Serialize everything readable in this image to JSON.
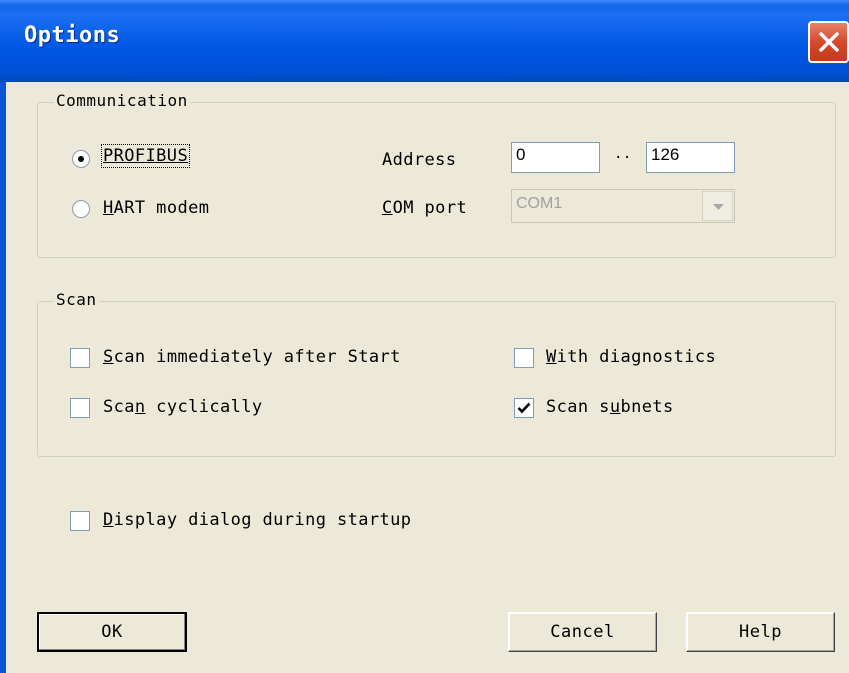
{
  "window": {
    "title": "Options"
  },
  "communication": {
    "group_label": "Communication",
    "profibus_label": "PROFIBUS",
    "hart_prefix": "H",
    "hart_label": "ART modem",
    "profibus_selected": true,
    "address_label": "Address",
    "address_from": "0",
    "address_separator": "··",
    "address_to": "126",
    "com_port_prefix": "C",
    "com_port_label": "OM port",
    "com_port_value": "COM1"
  },
  "scan": {
    "group_label": "Scan",
    "scan_immediately_prefix": "S",
    "scan_immediately_label": "can immediately after Start",
    "scan_immediately_checked": false,
    "scan_cyclically_a": "Sca",
    "scan_cyclically_u": "n",
    "scan_cyclically_b": " cyclically",
    "scan_cyclically_checked": false,
    "with_diag_prefix": "W",
    "with_diag_label": "ith diagnostics",
    "with_diag_checked": false,
    "scan_subnets_a": "Scan s",
    "scan_subnets_u": "u",
    "scan_subnets_b": "bnets",
    "scan_subnets_checked": true
  },
  "display_dialog": {
    "prefix": "D",
    "label": "isplay dialog during startup",
    "checked": false
  },
  "buttons": {
    "ok": "OK",
    "cancel": "Cancel",
    "help": "Help"
  },
  "icons": {
    "close": "close-icon",
    "dropdown": "chevron-down-icon",
    "check": "check-icon"
  }
}
